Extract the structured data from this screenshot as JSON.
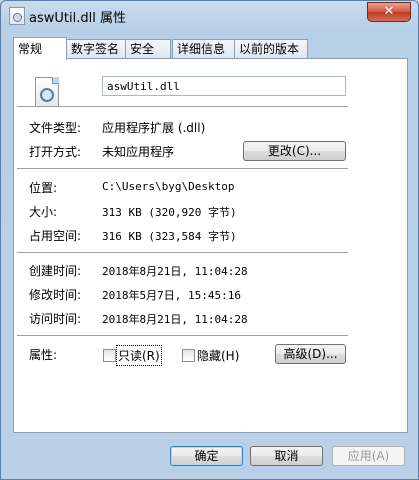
{
  "window": {
    "title": "aswUtil.dll 属性",
    "close_label": "✕"
  },
  "tabs": [
    "常规",
    "数字签名",
    "安全",
    "详细信息",
    "以前的版本"
  ],
  "file": {
    "name": "aswUtil.dll",
    "icon": "dll-file-icon"
  },
  "rows": {
    "type": {
      "label": "文件类型:",
      "value": "应用程序扩展 (.dll)"
    },
    "open_with": {
      "label": "打开方式:",
      "value": "未知应用程序",
      "button": "更改(C)..."
    },
    "location": {
      "label": "位置:",
      "value": "C:\\Users\\byg\\Desktop"
    },
    "size": {
      "label": "大小:",
      "value": "313 KB (320,920 字节)"
    },
    "size_on_disk": {
      "label": "占用空间:",
      "value": "316 KB (323,584 字节)"
    },
    "created": {
      "label": "创建时间:",
      "value": "2018年8月21日, 11:04:28"
    },
    "modified": {
      "label": "修改时间:",
      "value": "2018年5月7日, 15:45:16"
    },
    "accessed": {
      "label": "访问时间:",
      "value": "2018年8月21日, 11:04:28"
    }
  },
  "attributes": {
    "label": "属性:",
    "readonly": "只读(R)",
    "hidden": "隐藏(H)",
    "advanced": "高级(D)..."
  },
  "buttons": {
    "ok": "确定",
    "cancel": "取消",
    "apply": "应用(A)"
  }
}
